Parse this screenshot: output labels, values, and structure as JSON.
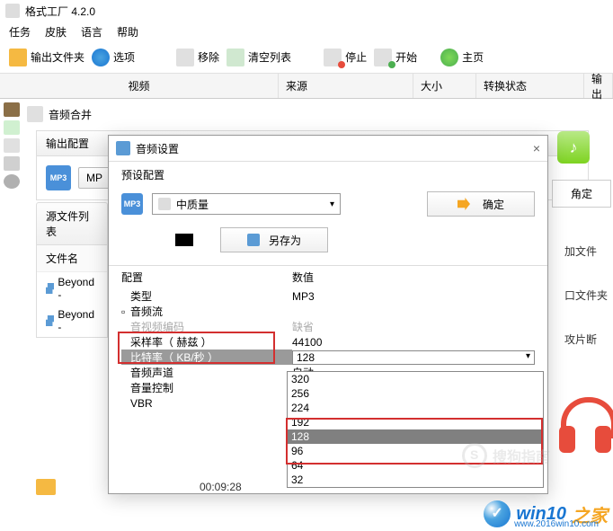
{
  "app": {
    "title": "格式工厂 4.2.0"
  },
  "menus": {
    "task": "任务",
    "skin": "皮肤",
    "language": "语言",
    "help": "帮助"
  },
  "toolbar": {
    "output_folder": "输出文件夹",
    "options": "选项",
    "remove": "移除",
    "clear_list": "清空列表",
    "stop": "停止",
    "start": "开始",
    "home": "主页"
  },
  "columns": {
    "video": "视频",
    "source": "来源",
    "size": "大小",
    "status": "转换状态",
    "output": "输出"
  },
  "merge": {
    "label": "音频合并"
  },
  "output_panel": {
    "title": "输出配置",
    "mp_button": "MP"
  },
  "files": {
    "section": "源文件列表",
    "header": "文件名",
    "items": [
      "Beyond -",
      "Beyond -"
    ]
  },
  "dialog": {
    "title": "音频设置",
    "preset_label": "预设配置",
    "preset_value": "中质量",
    "ok": "确定",
    "save_as": "另存为",
    "config_h": "配置",
    "value_h": "数值",
    "rows": {
      "type": "类型",
      "type_v": "MP3",
      "stream": "音频流",
      "codec": "音视频编码",
      "codec_v": "缺省",
      "sample": "采样率（ 赫兹 ）",
      "sample_v": "44100",
      "bitrate": "比特率（ KB/秒 ）",
      "bitrate_v": "128",
      "channel": "音频声道",
      "channel_v": "自动",
      "volume": "音量控制",
      "vbr": "VBR"
    },
    "bitrate_options": [
      "320",
      "256",
      "224",
      "192",
      "128",
      "96",
      "64",
      "32"
    ]
  },
  "right": {
    "ok": "角定",
    "add_file": "加文件",
    "add_folder": "口文件夹",
    "clip": "攻片断"
  },
  "bottom": {
    "time": "00:09:28"
  },
  "watermark": {
    "t1": "win10",
    "t2": "之家",
    "url": "www.2016win10.com"
  },
  "sogou": "搜狗指南"
}
